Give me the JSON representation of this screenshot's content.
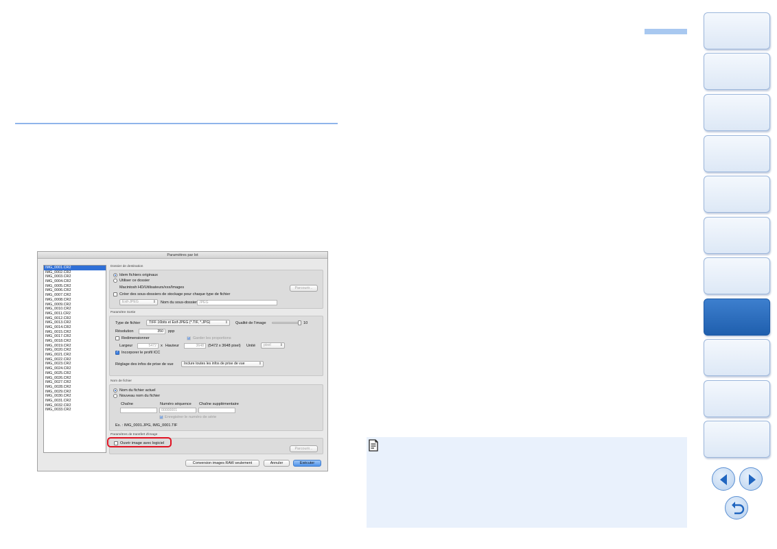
{
  "dialog": {
    "title": "Paramètres par lot",
    "files": [
      "IMG_0001.CR2",
      "IMG_0002.CR2",
      "IMG_0003.CR2",
      "IMG_0004.CR2",
      "IMG_0005.CR2",
      "IMG_0006.CR2",
      "IMG_0007.CR2",
      "IMG_0008.CR2",
      "IMG_0009.CR2",
      "IMG_0010.CR2",
      "IMG_0011.CR2",
      "IMG_0012.CR2",
      "IMG_0013.CR2",
      "IMG_0014.CR2",
      "IMG_0015.CR2",
      "IMG_0017.CR2",
      "IMG_0018.CR2",
      "IMG_0019.CR2",
      "IMG_0020.CR2",
      "IMG_0021.CR2",
      "IMG_0022.CR2",
      "IMG_0023.CR2",
      "IMG_0024.CR2",
      "IMG_0025.CR2",
      "IMG_0026.CR2",
      "IMG_0027.CR2",
      "IMG_0028.CR2",
      "IMG_0029.CR2",
      "IMG_0030.CR2",
      "IMG_0031.CR2",
      "IMG_0032.CR2",
      "IMG_0033.CR2"
    ],
    "selected_file": "IMG_0001.CR2",
    "destination": {
      "section_label": "Dossier de destination",
      "opt_same": "Idem fichiers originaux",
      "opt_folder": "Utiliser ce dossier",
      "path": "Macintosh HD/Utilisateurs/xxx/Images",
      "browse": "Parcourir...",
      "subfolder_check": "Créer des sous-dossiers de stockage pour chaque type de fichier",
      "subfolder_type": "Exif-JPEG",
      "subfolder_name_label": "Nom du sous-dossier",
      "subfolder_name_value": "JPEG"
    },
    "output": {
      "section_label": "Paramètre Sortie",
      "file_type_label": "Type de fichier",
      "file_type_value": "TIFF 16bits et Exif-JPEG (*.TIF, *.JPG)",
      "quality_label": "Qualité de l'image",
      "quality_value": "10",
      "quality_level": 10,
      "quality_max": 10,
      "resolution_label": "Résolution",
      "resolution_value": "350",
      "resolution_unit": "ppp",
      "resize_label": "Redimensionner",
      "keep_ratio_label": "Garder les proportions",
      "width_label": "Largeur",
      "width_value": "5472",
      "x_label": "x",
      "height_label": "Hauteur",
      "height_value": "3648",
      "size_text": "(5472 x 3648 pixel)",
      "unit_label": "Unité",
      "unit_value": "pixel",
      "icc_label": "Incorporer le profil ICC",
      "shooting_info_label": "Réglage des infos de prise de vue",
      "shooting_info_value": "Inclure toutes les infos de prise de vue"
    },
    "filename": {
      "section_label": "Nom de fichier",
      "opt_current": "Nom du fichier actuel",
      "opt_new": "Nouveau nom du fichier",
      "chain_label": "Chaîne",
      "seq_label": "Numéro séquence",
      "seq_value": "00000001",
      "extra_label": "Chaîne supplémentaire",
      "save_serial": "Enregistrer le numéro de série",
      "example": "Ex. :   IMG_0001.JPG, IMG_0001.TIF"
    },
    "transfer": {
      "section_label": "Paramètres de transfert d'image",
      "open_with_app": "Ouvrir image avec logiciel",
      "browse": "Parcourir..."
    },
    "buttons": {
      "raw_only": "Conversion images RAW seulement",
      "cancel": "Annuler",
      "run": "Exécuter"
    }
  },
  "colors": {
    "accent_blue": "#2166c0",
    "highlight_red": "#e01020",
    "note_bg": "#e9f1fc"
  },
  "nav": {
    "tab_count": 11,
    "active_tab_index": 7,
    "icons": [
      "prev-arrow-icon",
      "next-arrow-icon",
      "return-icon"
    ]
  }
}
